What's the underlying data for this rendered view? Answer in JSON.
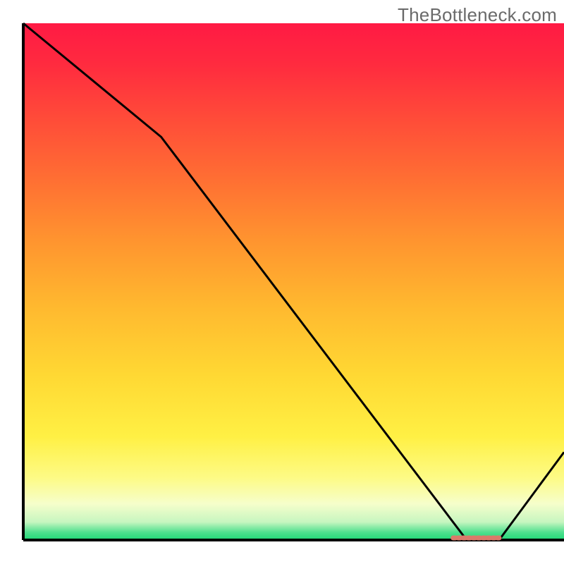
{
  "watermark": "TheBottleneck.com",
  "chart_data": {
    "type": "line",
    "title": "",
    "xlabel": "",
    "ylabel": "",
    "xlim": [
      0,
      100
    ],
    "ylim": [
      0,
      100
    ],
    "x": [
      0,
      25.5,
      82,
      88,
      100
    ],
    "values": [
      100,
      78,
      0,
      0,
      17
    ],
    "marker": {
      "x_start": 79.5,
      "x_end": 88,
      "y": 0,
      "color": "#d97a6a"
    },
    "background": {
      "type": "vertical_gradient",
      "stops": [
        {
          "offset": 0.0,
          "color": "#ff1a44"
        },
        {
          "offset": 0.08,
          "color": "#ff2b3f"
        },
        {
          "offset": 0.18,
          "color": "#ff4a39"
        },
        {
          "offset": 0.3,
          "color": "#ff6e33"
        },
        {
          "offset": 0.42,
          "color": "#ff942f"
        },
        {
          "offset": 0.55,
          "color": "#ffb92f"
        },
        {
          "offset": 0.68,
          "color": "#ffd833"
        },
        {
          "offset": 0.8,
          "color": "#fff044"
        },
        {
          "offset": 0.88,
          "color": "#fdfb86"
        },
        {
          "offset": 0.93,
          "color": "#f6fecb"
        },
        {
          "offset": 0.965,
          "color": "#c7f6c0"
        },
        {
          "offset": 0.985,
          "color": "#4fe08e"
        },
        {
          "offset": 1.0,
          "color": "#1fd876"
        }
      ]
    },
    "axes": {
      "left": true,
      "bottom": true,
      "top": false,
      "right": false,
      "color": "#000000",
      "linewidth": 4
    },
    "line_style": {
      "color": "#000000",
      "linewidth": 3
    }
  }
}
